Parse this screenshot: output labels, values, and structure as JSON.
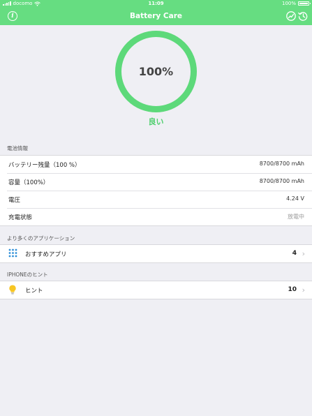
{
  "status_bar": {
    "carrier": "docomo",
    "time": "11:09",
    "battery_text": "100%",
    "icons": [
      "signal-icon",
      "wifi-icon",
      "battery-icon"
    ]
  },
  "nav": {
    "title": "Battery Care",
    "info_symbol": "i",
    "left_icon": "info-icon",
    "right_icons": [
      "chart-icon",
      "history-icon"
    ]
  },
  "gauge": {
    "value_text": "100%",
    "level": 1.0,
    "status": "良い",
    "ring_color": "#5dd97a"
  },
  "colors": {
    "accent": "#66dd81",
    "chevron": "#b5b5ba",
    "app_grid": "#2f8fd8",
    "bulb": "#f7c623"
  },
  "sections": {
    "battery_info": {
      "header": "電池情報",
      "rows": [
        {
          "label": "バッテリー残量（100 %）",
          "value": "8700/8700 mAh"
        },
        {
          "label": "容量（100%）",
          "value": "8700/8700 mAh"
        },
        {
          "label": "電圧",
          "value": "4.24 V"
        },
        {
          "label": "充電状態",
          "value": "放電中"
        }
      ]
    },
    "more_apps": {
      "header": "より多くのアプリケーション",
      "row": {
        "icon": "app-grid-icon",
        "label": "おすすめアプリ",
        "count": "4"
      }
    },
    "hints": {
      "header": "IPHONEのヒント",
      "row": {
        "icon": "lightbulb-icon",
        "label": "ヒント",
        "count": "10"
      }
    }
  }
}
